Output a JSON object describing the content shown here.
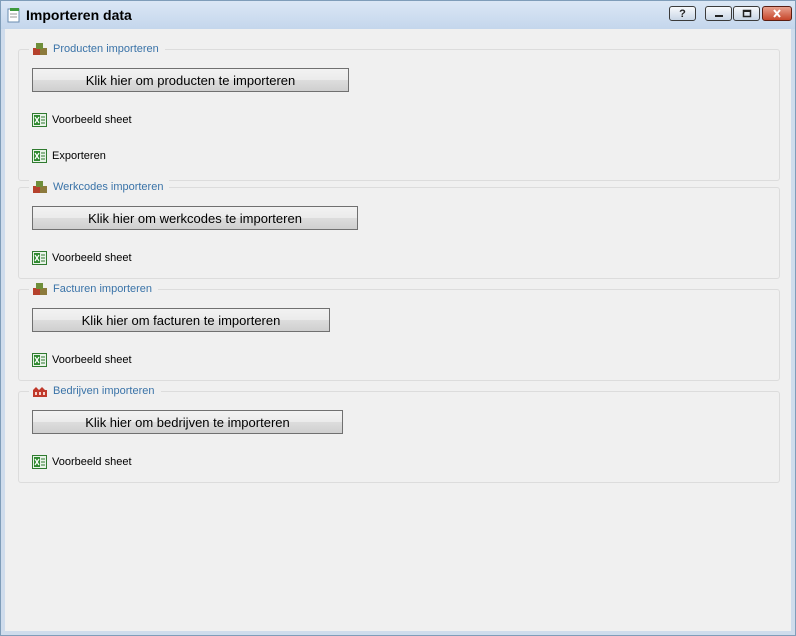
{
  "window": {
    "title": "Importeren data",
    "help_label": "?",
    "colors": {
      "legend": "#3a73a8",
      "frame": "#cfdcec"
    }
  },
  "sections": [
    {
      "legend": "Producten importeren",
      "icon": "boxes-icon",
      "button_label": "Klik hier om producten te importeren",
      "links": [
        "Voorbeeld sheet",
        "Exporteren"
      ]
    },
    {
      "legend": "Werkcodes importeren",
      "icon": "boxes-icon",
      "button_label": "Klik hier om werkcodes te importeren",
      "links": [
        "Voorbeeld sheet"
      ]
    },
    {
      "legend": "Facturen importeren",
      "icon": "boxes-icon",
      "button_label": "Klik hier om facturen te importeren",
      "links": [
        "Voorbeeld sheet"
      ]
    },
    {
      "legend": "Bedrijven importeren",
      "icon": "factory-icon",
      "button_label": "Klik hier om bedrijven te importeren",
      "links": [
        "Voorbeeld sheet"
      ]
    }
  ]
}
